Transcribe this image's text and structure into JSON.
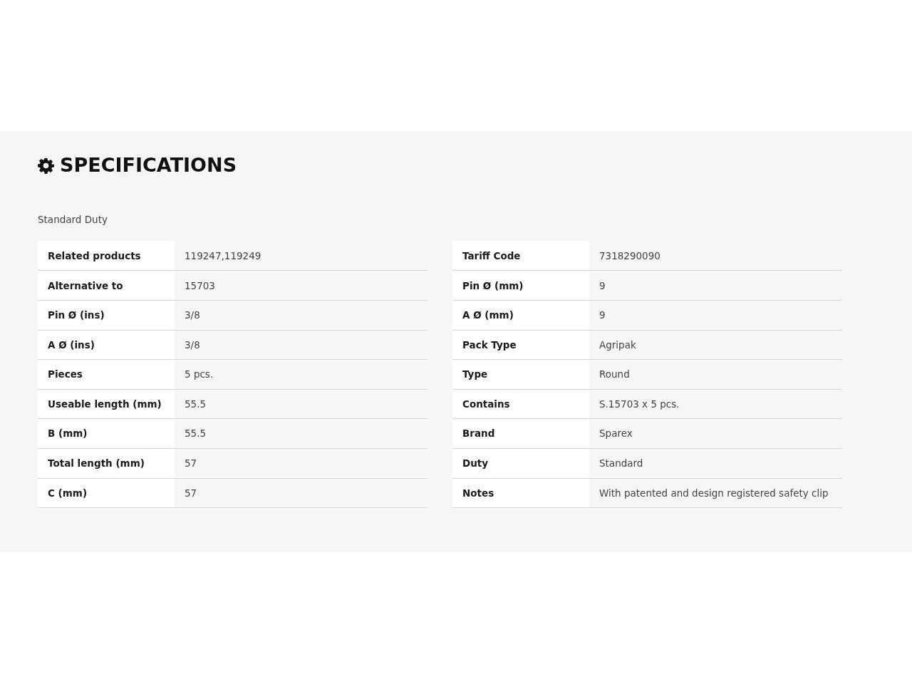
{
  "section": {
    "title": "SPECIFICATIONS",
    "subtitle": "Standard Duty"
  },
  "tables": [
    {
      "rows": [
        {
          "label": "Related products",
          "value": "119247,119249"
        },
        {
          "label": "Alternative to",
          "value": "15703"
        },
        {
          "label": "Pin Ø (ins)",
          "value": "3/8"
        },
        {
          "label": "A Ø (ins)",
          "value": "3/8"
        },
        {
          "label": "Pieces",
          "value": "5 pcs."
        },
        {
          "label": "Useable length (mm)",
          "value": "55.5"
        },
        {
          "label": "B (mm)",
          "value": "55.5"
        },
        {
          "label": "Total length (mm)",
          "value": "57"
        },
        {
          "label": "C (mm)",
          "value": "57"
        }
      ]
    },
    {
      "rows": [
        {
          "label": "Tariff Code",
          "value": "7318290090"
        },
        {
          "label": "Pin Ø (mm)",
          "value": "9"
        },
        {
          "label": "A Ø (mm)",
          "value": "9"
        },
        {
          "label": "Pack Type",
          "value": "Agripak"
        },
        {
          "label": "Type",
          "value": "Round"
        },
        {
          "label": "Contains",
          "value": "S.15703 x 5 pcs."
        },
        {
          "label": "Brand",
          "value": "Sparex"
        },
        {
          "label": "Duty",
          "value": "Standard"
        },
        {
          "label": "Notes",
          "value": "With patented and design registered safety clip"
        }
      ]
    }
  ]
}
